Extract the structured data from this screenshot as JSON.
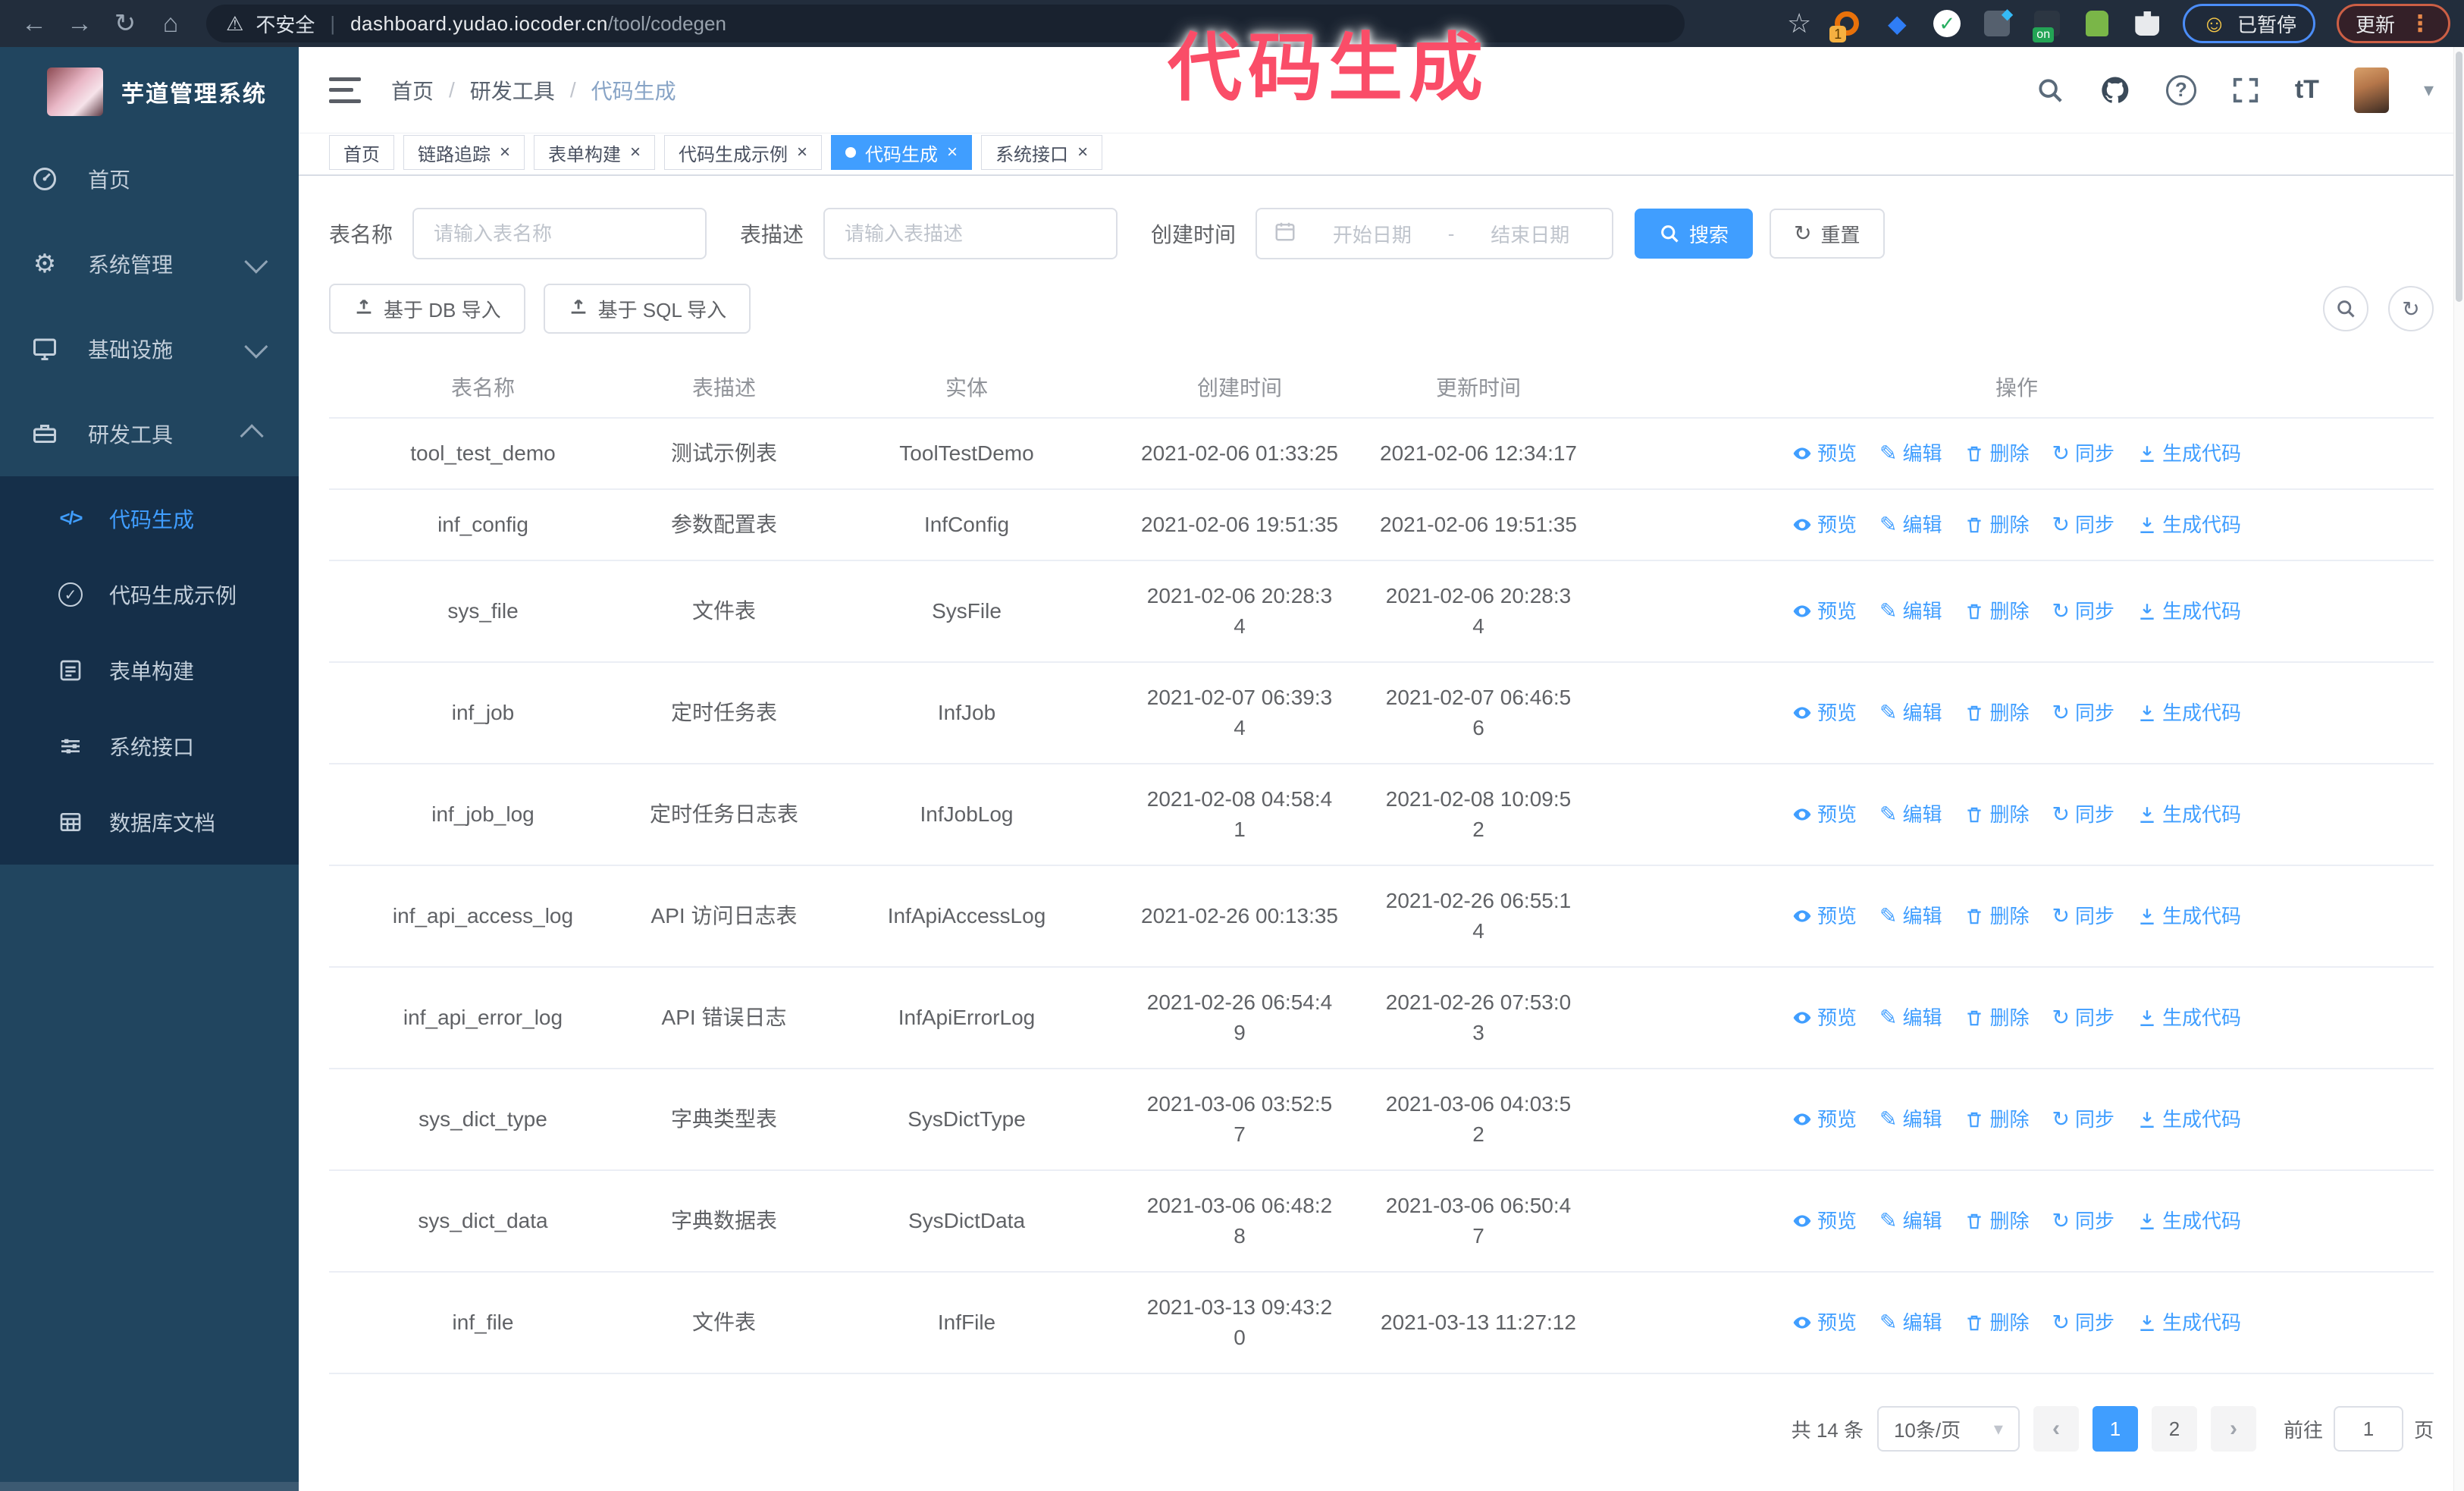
{
  "glyphs": {
    "back": "←",
    "forward": "→",
    "reload": "↻",
    "home": "⌂",
    "warning": "⚠",
    "divider": "|",
    "star": "☆",
    "smiley": "☺",
    "dots_vertical": "⋮",
    "breadcrumb_sep": "/",
    "caret_down": "▾",
    "question": "?",
    "font_size": "tT",
    "pen": "✎",
    "sync": "↻",
    "close": "×",
    "dot_prev": "‹",
    "dot_next": "›",
    "gear": "⚙",
    "code": "</>",
    "check": "✓",
    "ext_badge": "1",
    "ext_on": "on",
    "range_sep": "-",
    "select_caret": "▾"
  },
  "browser": {
    "security_label": "不安全",
    "url_host": "dashboard.yudao.iocoder.cn",
    "url_path": "/tool/codegen",
    "paused_label": "已暂停",
    "update_label": "更新"
  },
  "watermark": "代码生成",
  "sidebar": {
    "title": "芋道管理系统",
    "items": [
      {
        "label": "首页"
      },
      {
        "label": "系统管理"
      },
      {
        "label": "基础设施"
      },
      {
        "label": "研发工具"
      }
    ],
    "submenu": [
      {
        "label": "代码生成"
      },
      {
        "label": "代码生成示例"
      },
      {
        "label": "表单构建"
      },
      {
        "label": "系统接口"
      },
      {
        "label": "数据库文档"
      }
    ]
  },
  "header": {
    "breadcrumb": [
      "首页",
      "研发工具",
      "代码生成"
    ]
  },
  "tabs": [
    {
      "label": "首页"
    },
    {
      "label": "链路追踪"
    },
    {
      "label": "表单构建"
    },
    {
      "label": "代码生成示例"
    },
    {
      "label": "代码生成"
    },
    {
      "label": "系统接口"
    }
  ],
  "filters": {
    "name_label": "表名称",
    "name_placeholder": "请输入表名称",
    "desc_label": "表描述",
    "desc_placeholder": "请输入表描述",
    "time_label": "创建时间",
    "start_placeholder": "开始日期",
    "end_placeholder": "结束日期",
    "search_label": "搜索",
    "reset_label": "重置"
  },
  "toolbar": {
    "import_db_label": "基于 DB 导入",
    "import_sql_label": "基于 SQL 导入"
  },
  "table": {
    "columns": [
      "表名称",
      "表描述",
      "实体",
      "创建时间",
      "更新时间",
      "操作"
    ],
    "actions": [
      "预览",
      "编辑",
      "删除",
      "同步",
      "生成代码"
    ],
    "rows": [
      {
        "name": "tool_test_demo",
        "desc": "测试示例表",
        "entity": "ToolTestDemo",
        "created": "2021-02-06 01:33:25",
        "updated": "2021-02-06 12:34:17"
      },
      {
        "name": "inf_config",
        "desc": "参数配置表",
        "entity": "InfConfig",
        "created": "2021-02-06 19:51:35",
        "updated": "2021-02-06 19:51:35"
      },
      {
        "name": "sys_file",
        "desc": "文件表",
        "entity": "SysFile",
        "created": "2021-02-06 20:28:3\n4",
        "updated": "2021-02-06 20:28:3\n4"
      },
      {
        "name": "inf_job",
        "desc": "定时任务表",
        "entity": "InfJob",
        "created": "2021-02-07 06:39:3\n4",
        "updated": "2021-02-07 06:46:5\n6"
      },
      {
        "name": "inf_job_log",
        "desc": "定时任务日志表",
        "entity": "InfJobLog",
        "created": "2021-02-08 04:58:4\n1",
        "updated": "2021-02-08 10:09:5\n2"
      },
      {
        "name": "inf_api_access_log",
        "desc": "API 访问日志表",
        "entity": "InfApiAccessLog",
        "created": "2021-02-26 00:13:35",
        "updated": "2021-02-26 06:55:1\n4"
      },
      {
        "name": "inf_api_error_log",
        "desc": "API 错误日志",
        "entity": "InfApiErrorLog",
        "created": "2021-02-26 06:54:4\n9",
        "updated": "2021-02-26 07:53:0\n3"
      },
      {
        "name": "sys_dict_type",
        "desc": "字典类型表",
        "entity": "SysDictType",
        "created": "2021-03-06 03:52:5\n7",
        "updated": "2021-03-06 04:03:5\n2"
      },
      {
        "name": "sys_dict_data",
        "desc": "字典数据表",
        "entity": "SysDictData",
        "created": "2021-03-06 06:48:2\n8",
        "updated": "2021-03-06 06:50:4\n7"
      },
      {
        "name": "inf_file",
        "desc": "文件表",
        "entity": "InfFile",
        "created": "2021-03-13 09:43:2\n0",
        "updated": "2021-03-13 11:27:12"
      }
    ]
  },
  "pagination": {
    "total": "共 14 条",
    "page_size": "10条/页",
    "page_1": "1",
    "page_2": "2",
    "goto_label": "前往",
    "goto_value": "1",
    "page_suffix": "页"
  },
  "colors": {
    "primary": "#409eff",
    "sidebar_bg": "#21455f",
    "submenu_bg": "#152f49",
    "browser_bar": "#222d3c",
    "watermark_pink": "#fa4d68",
    "paused_border": "#4b8df8",
    "update_border": "#cc5f45"
  }
}
